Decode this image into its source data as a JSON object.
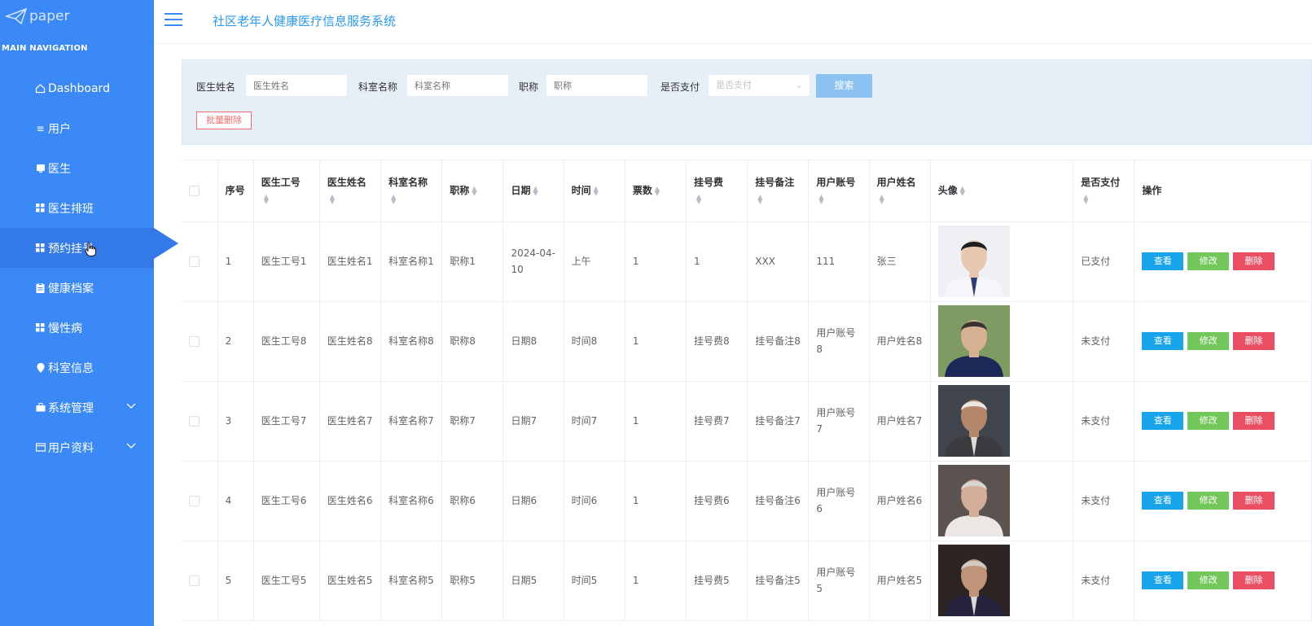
{
  "logo": {
    "text": "paper"
  },
  "nav": {
    "heading": "MAIN NAVIGATION",
    "items": [
      {
        "label": "Dashboard",
        "icon": "home-icon"
      },
      {
        "label": "用户",
        "icon": "list-icon"
      },
      {
        "label": "医生",
        "icon": "monitor-icon"
      },
      {
        "label": "医生排班",
        "icon": "grid-icon"
      },
      {
        "label": "预约挂号",
        "icon": "grid-icon"
      },
      {
        "label": "健康档案",
        "icon": "clipboard-icon"
      },
      {
        "label": "慢性病",
        "icon": "grid-icon"
      },
      {
        "label": "科室信息",
        "icon": "location-pin-icon"
      },
      {
        "label": "系统管理",
        "icon": "briefcase-icon"
      },
      {
        "label": "用户资料",
        "icon": "card-icon"
      }
    ]
  },
  "header": {
    "title": "社区老年人健康医疗信息服务系统"
  },
  "search": {
    "doctor_name_label": "医生姓名",
    "doctor_name_placeholder": "医生姓名",
    "dept_label": "科室名称",
    "dept_placeholder": "科室名称",
    "title_label": "职称",
    "title_placeholder": "职称",
    "paid_label": "是否支付",
    "paid_placeholder": "是否支付",
    "search_button": "搜索",
    "batch_delete": "批量删除"
  },
  "table": {
    "columns": [
      "序号",
      "医生工号",
      "医生姓名",
      "科室名称",
      "职称",
      "日期",
      "时间",
      "票数",
      "挂号费",
      "挂号备注",
      "用户账号",
      "用户姓名",
      "头像",
      "是否支付",
      "操作"
    ],
    "actions": {
      "view": "查看",
      "edit": "修改",
      "delete": "删除"
    },
    "rows": [
      {
        "idx": "1",
        "doc_no": "医生工号1",
        "doc_name": "医生姓名1",
        "dept": "科室名称1",
        "title": "职称1",
        "date": "2024-04-10",
        "time": "上午",
        "tickets": "1",
        "fee": "1",
        "note": "XXX",
        "account": "111",
        "user_name": "张三",
        "paid": "已支付"
      },
      {
        "idx": "2",
        "doc_no": "医生工号8",
        "doc_name": "医生姓名8",
        "dept": "科室名称8",
        "title": "职称8",
        "date": "日期8",
        "time": "时间8",
        "tickets": "1",
        "fee": "挂号费8",
        "note": "挂号备注8",
        "account": "用户账号8",
        "user_name": "用户姓名8",
        "paid": "未支付"
      },
      {
        "idx": "3",
        "doc_no": "医生工号7",
        "doc_name": "医生姓名7",
        "dept": "科室名称7",
        "title": "职称7",
        "date": "日期7",
        "time": "时间7",
        "tickets": "1",
        "fee": "挂号费7",
        "note": "挂号备注7",
        "account": "用户账号7",
        "user_name": "用户姓名7",
        "paid": "未支付"
      },
      {
        "idx": "4",
        "doc_no": "医生工号6",
        "doc_name": "医生姓名6",
        "dept": "科室名称6",
        "title": "职称6",
        "date": "日期6",
        "time": "时间6",
        "tickets": "1",
        "fee": "挂号费6",
        "note": "挂号备注6",
        "account": "用户账号6",
        "user_name": "用户姓名6",
        "paid": "未支付"
      },
      {
        "idx": "5",
        "doc_no": "医生工号5",
        "doc_name": "医生姓名5",
        "dept": "科室名称5",
        "title": "职称5",
        "date": "日期5",
        "time": "时间5",
        "tickets": "1",
        "fee": "挂号费5",
        "note": "挂号备注5",
        "account": "用户账号5",
        "user_name": "用户姓名5",
        "paid": "未支付"
      }
    ]
  }
}
